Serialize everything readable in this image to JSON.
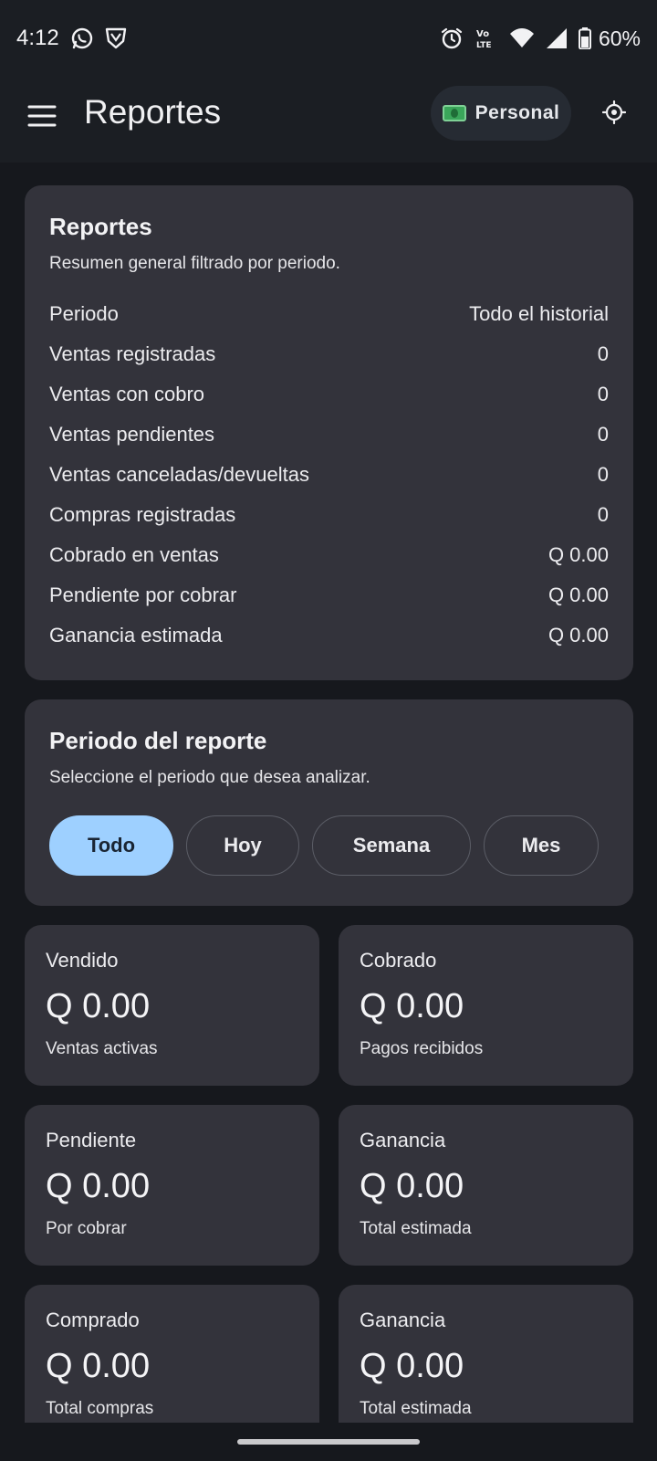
{
  "status_bar": {
    "time": "4:12",
    "battery": "60%",
    "icons": [
      "whatsapp-icon",
      "shield-icon",
      "alarm-icon",
      "volte-icon",
      "wifi-icon",
      "signal-icon",
      "battery-icon"
    ]
  },
  "app_bar": {
    "title": "Reportes",
    "profile_chip": "Personal",
    "accent": "#9ed0ff"
  },
  "summary": {
    "title": "Reportes",
    "subtitle": "Resumen general filtrado por periodo.",
    "rows": [
      {
        "label": "Periodo",
        "value": "Todo el historial"
      },
      {
        "label": "Ventas registradas",
        "value": "0"
      },
      {
        "label": "Ventas con cobro",
        "value": "0"
      },
      {
        "label": "Ventas pendientes",
        "value": "0"
      },
      {
        "label": "Ventas canceladas/devueltas",
        "value": "0"
      },
      {
        "label": "Compras registradas",
        "value": "0"
      },
      {
        "label": "Cobrado en ventas",
        "value": "Q 0.00"
      },
      {
        "label": "Pendiente por cobrar",
        "value": "Q 0.00"
      },
      {
        "label": "Ganancia estimada",
        "value": "Q 0.00"
      }
    ]
  },
  "period": {
    "title": "Periodo del reporte",
    "subtitle": "Seleccione el periodo que desea analizar.",
    "options": [
      {
        "label": "Todo",
        "selected": true
      },
      {
        "label": "Hoy",
        "selected": false
      },
      {
        "label": "Semana",
        "selected": false
      },
      {
        "label": "Mes",
        "selected": false
      }
    ]
  },
  "stats": [
    {
      "label": "Vendido",
      "value": "Q 0.00",
      "sub": "Ventas activas"
    },
    {
      "label": "Cobrado",
      "value": "Q 0.00",
      "sub": "Pagos recibidos"
    },
    {
      "label": "Pendiente",
      "value": "Q 0.00",
      "sub": "Por cobrar"
    },
    {
      "label": "Ganancia",
      "value": "Q 0.00",
      "sub": "Total estimada"
    },
    {
      "label": "Comprado",
      "value": "Q 0.00",
      "sub": "Total compras"
    },
    {
      "label": "Ganancia",
      "value": "Q 0.00",
      "sub": "Total estimada"
    }
  ]
}
